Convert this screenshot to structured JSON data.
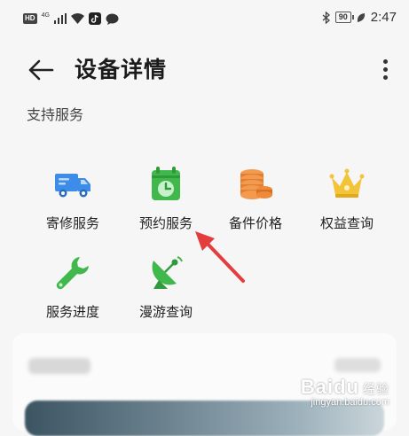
{
  "status_bar": {
    "network_badge": "HD",
    "signal_label": "4G",
    "battery": "90",
    "time": "2:47"
  },
  "header": {
    "title": "设备详情",
    "back_icon": "arrow-left-icon",
    "menu_icon": "more-vertical-icon"
  },
  "section": {
    "title": "支持服务"
  },
  "services": [
    {
      "label": "寄修服务",
      "icon": "truck-icon",
      "color": "#3d8ce8"
    },
    {
      "label": "预约服务",
      "icon": "calendar-clock-icon",
      "color": "#41b84c"
    },
    {
      "label": "备件价格",
      "icon": "coins-icon",
      "color": "#ee8a3c"
    },
    {
      "label": "权益查询",
      "icon": "crown-icon",
      "color": "#f3c33a"
    },
    {
      "label": "服务进度",
      "icon": "wrench-icon",
      "color": "#41b84c"
    },
    {
      "label": "漫游查询",
      "icon": "satellite-dish-icon",
      "color": "#41b84c"
    }
  ],
  "annotation": {
    "arrow_color": "#e43d3d"
  },
  "watermark": {
    "logo": "Baidu",
    "suffix": "经验",
    "url": "jingyan.baidu.com"
  }
}
